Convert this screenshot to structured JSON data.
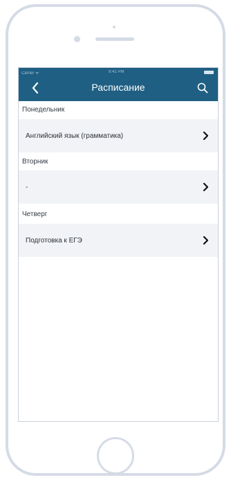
{
  "status_bar": {
    "carrier": "Carrier ᯤ",
    "time": "9:41 PM"
  },
  "navbar": {
    "title": "Расписание",
    "back_icon": "chevron-left-icon",
    "search_icon": "search-icon"
  },
  "schedule": [
    {
      "day": "Понедельник",
      "lesson": "Английский язык (грамматика)"
    },
    {
      "day": "Вторник",
      "lesson": "-"
    },
    {
      "day": "Четверг",
      "lesson": "Подготовка к ЕГЭ"
    }
  ],
  "colors": {
    "navbar": "#1f5f83",
    "row_bg": "#f1f3f6",
    "frame": "#d5dbe6"
  }
}
